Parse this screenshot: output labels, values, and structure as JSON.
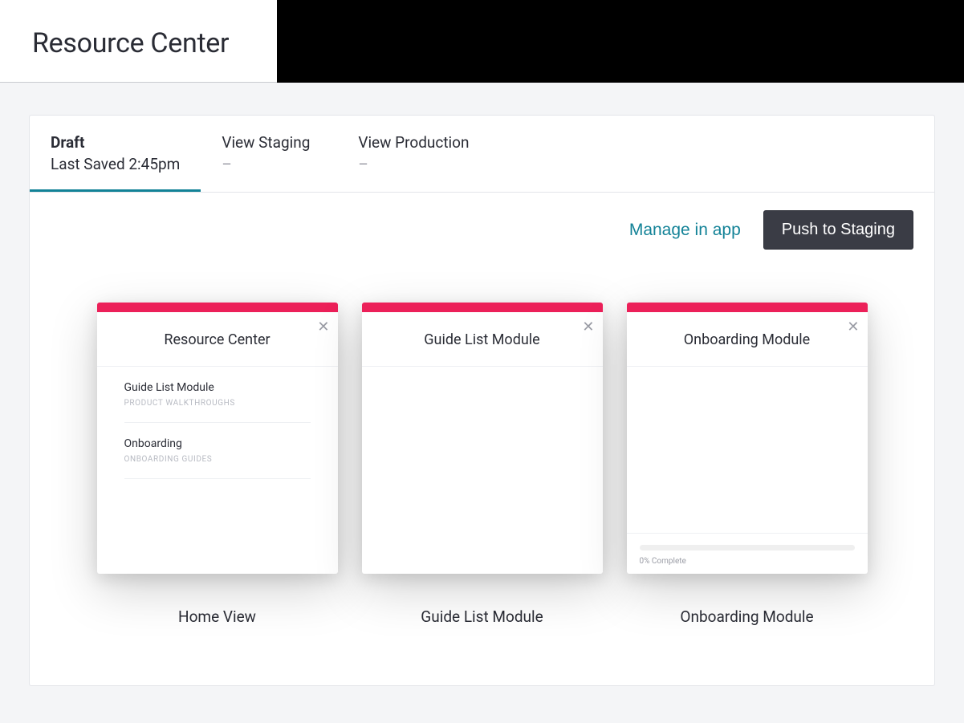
{
  "header": {
    "title": "Resource Center"
  },
  "tabs": [
    {
      "title": "Draft",
      "sub": "Last Saved 2:45pm",
      "active": true
    },
    {
      "title": "View Staging",
      "sub": "–",
      "active": false
    },
    {
      "title": "View Production",
      "sub": "–",
      "active": false
    }
  ],
  "actions": {
    "manage": "Manage in app",
    "push": "Push to Staging"
  },
  "accent": "#ec2059",
  "cards": [
    {
      "title": "Resource Center",
      "caption": "Home View",
      "items": [
        {
          "title": "Guide List Module",
          "sub": "PRODUCT WALKTHROUGHS"
        },
        {
          "title": "Onboarding",
          "sub": "ONBOARDING GUIDES"
        }
      ]
    },
    {
      "title": "Guide List Module",
      "caption": "Guide List Module",
      "items": []
    },
    {
      "title": "Onboarding Module",
      "caption": "Onboarding Module",
      "items": [],
      "progress": {
        "percent": 0,
        "label": "0% Complete"
      }
    }
  ]
}
